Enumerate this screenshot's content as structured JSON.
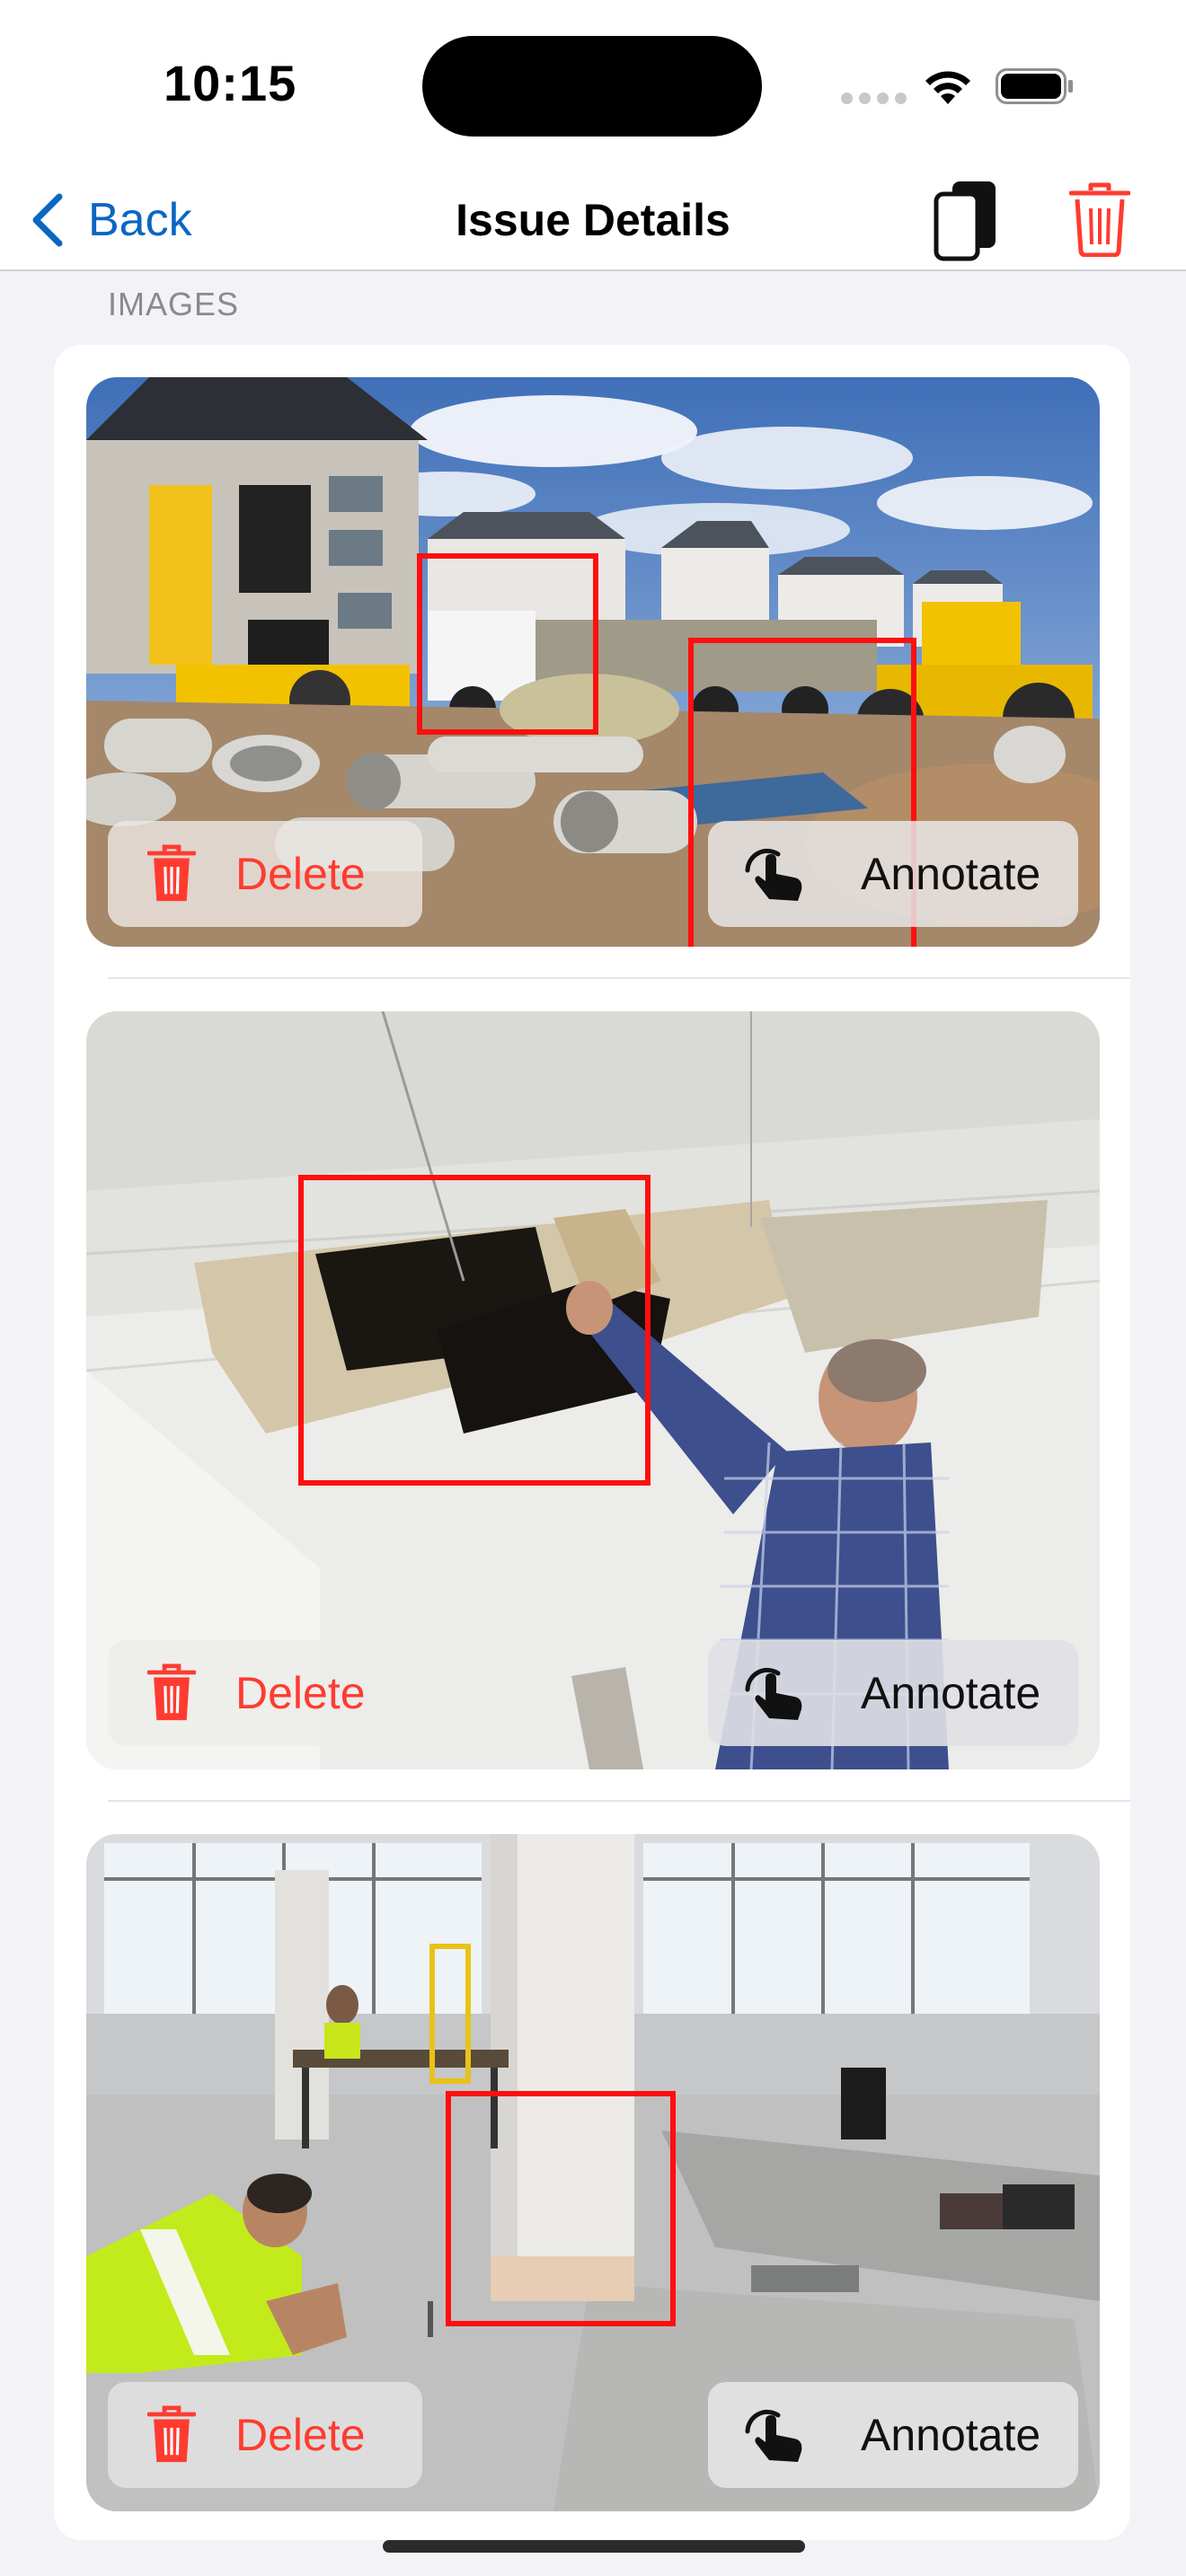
{
  "status_bar": {
    "time": "10:15"
  },
  "nav": {
    "back_label": "Back",
    "title": "Issue Details",
    "icons": [
      "chevron-left-icon",
      "copy-device-icon",
      "trash-icon"
    ],
    "accent_color": "#0a66c2",
    "destructive_color": "#ff3b30"
  },
  "section": {
    "header": "IMAGES"
  },
  "images": [
    {
      "scene": "construction site with yellow excavators, concrete pipes, and new houses",
      "annotations": 2,
      "delete_label": "Delete",
      "annotate_label": "Annotate"
    },
    {
      "scene": "man in plaid shirt repairing a damaged ceiling tile",
      "annotations": 1,
      "delete_label": "Delete",
      "annotate_label": "Annotate"
    },
    {
      "scene": "office interior under renovation with worker in hi-vis vest and white column",
      "annotations": 1,
      "delete_label": "Delete",
      "annotate_label": "Annotate"
    }
  ],
  "colors": {
    "annotation_box": "#ff0f0f",
    "background": "#f2f2f7"
  }
}
